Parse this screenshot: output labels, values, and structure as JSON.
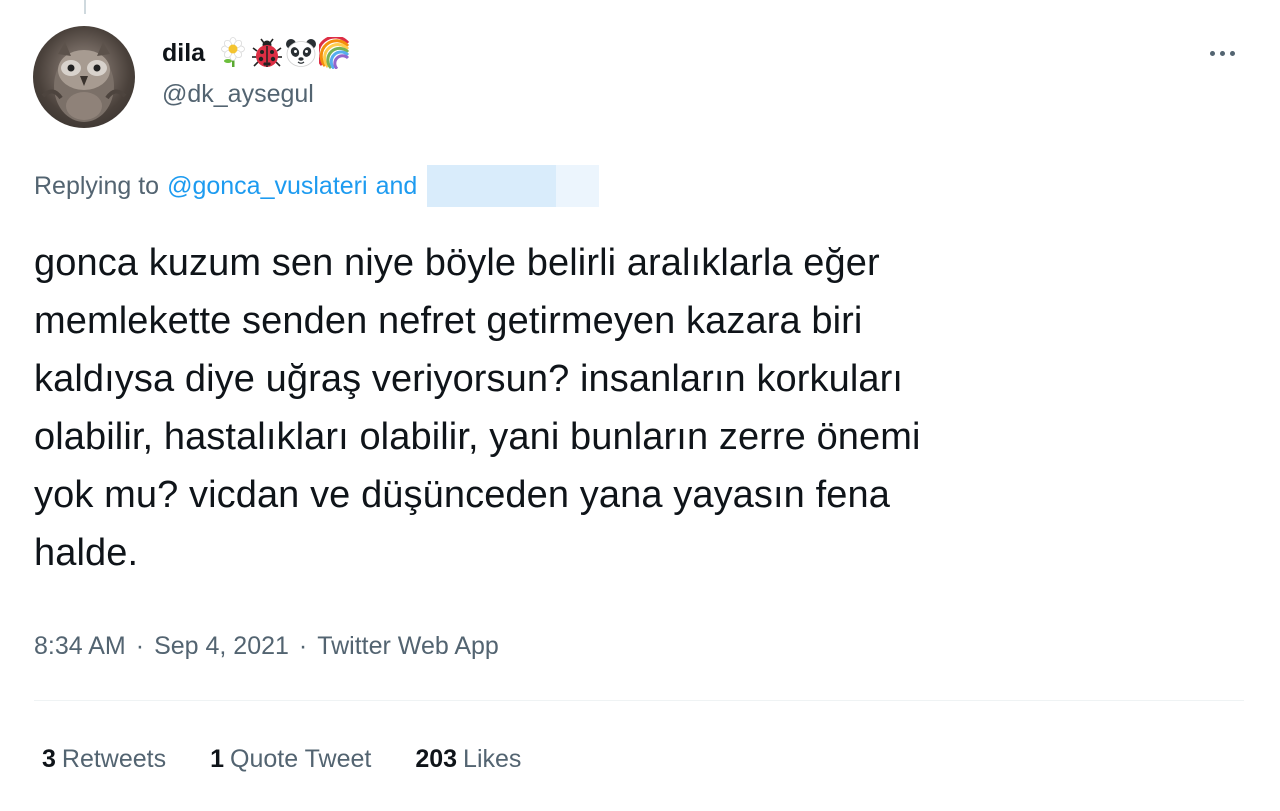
{
  "author": {
    "display_name": "dila",
    "handle": "@dk_aysegul",
    "avatar_icon": "owl-avatar-icon",
    "emojis": [
      "daisy-icon",
      "ladybug-icon",
      "panda-icon",
      "rainbow-icon"
    ]
  },
  "reply": {
    "prefix": "Replying to",
    "mention": "@gonca_vuslateri",
    "conjunction": "and"
  },
  "tweet": {
    "text": "gonca kuzum sen niye böyle belirli aralıklarla eğer\nmemlekette senden nefret getirmeyen kazara biri\nkaldıysa diye uğraş veriyorsun? insanların korkuları\nolabilir, hastalıkları olabilir, yani bunların zerre önemi\nyok mu? vicdan ve düşünceden yana yayasın fena\nhalde."
  },
  "meta": {
    "time": "8:34 AM",
    "separator": "·",
    "date": "Sep 4, 2021",
    "source": "Twitter Web App"
  },
  "stats": {
    "retweets_count": "3",
    "retweets_label": "Retweets",
    "quotes_count": "1",
    "quotes_label": "Quote Tweet",
    "likes_count": "203",
    "likes_label": "Likes"
  },
  "colors": {
    "text_primary": "#0f1419",
    "text_secondary": "#536471",
    "link": "#1d9bf0",
    "divider": "#eff3f4"
  }
}
